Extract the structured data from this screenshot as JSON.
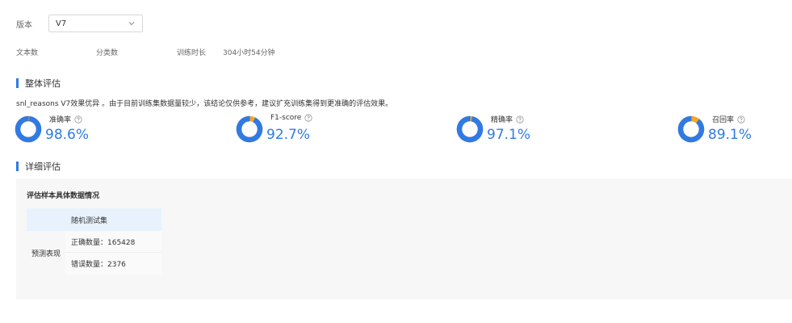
{
  "version": {
    "label": "版本",
    "selected": "V7",
    "icon": "chevron-down-icon"
  },
  "meta": {
    "text_count_label": "文本数",
    "class_count_label": "分类数",
    "train_time_label": "训练时长",
    "train_time_value": "304小时54分钟"
  },
  "overall": {
    "title": "整体评估",
    "summary": "snl_reasons V7效果优异 。由于目前训练集数据量较少，该结论仅供参考，建议扩充训练集得到更准确的评估效果。",
    "metrics": [
      {
        "label": "准确率",
        "value": "98.6%",
        "ratio": 0.986
      },
      {
        "label": "F1-score",
        "value": "92.7%",
        "ratio": 0.927
      },
      {
        "label": "精确率",
        "value": "97.1%",
        "ratio": 0.971
      },
      {
        "label": "召回率",
        "value": "89.1%",
        "ratio": 0.891
      }
    ],
    "colors": {
      "primary": "#2f7ae5",
      "secondary": "#f5a623"
    }
  },
  "detail": {
    "title": "详细评估",
    "panel_title": "评估样本具体数据情况",
    "table": {
      "column_header": "随机测试集",
      "row_header": "预测表现",
      "correct": "正确数量：165428",
      "wrong": "错误数量：2376"
    }
  }
}
